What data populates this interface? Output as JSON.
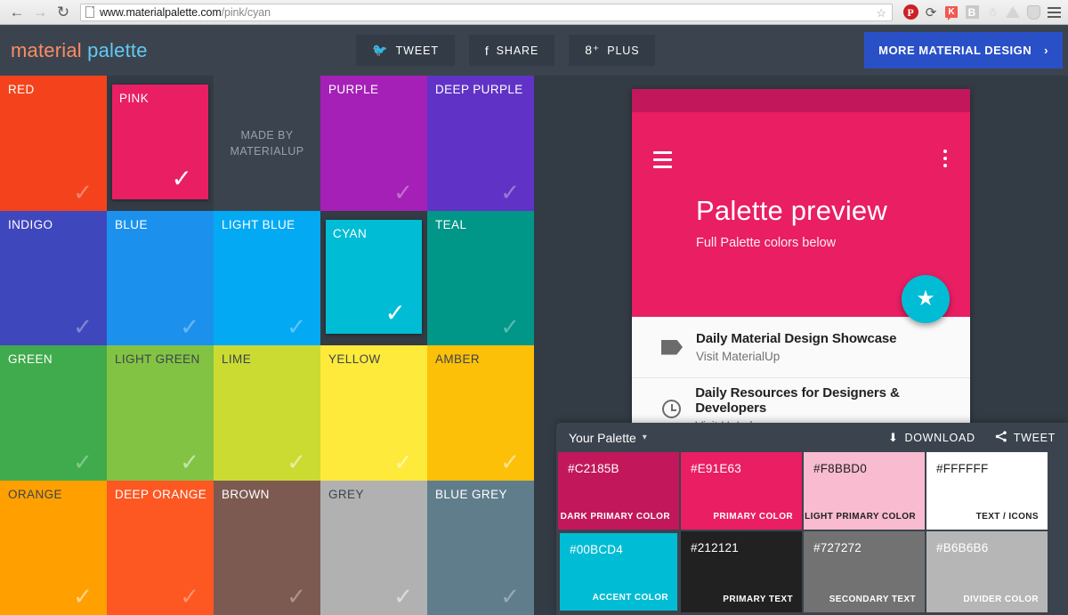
{
  "browser": {
    "back_icon": "back-arrow-icon",
    "forward_icon": "forward-arrow-icon",
    "reload_icon": "reload-icon",
    "url_host": "www.materialpalette.com",
    "url_path": "/pink/cyan",
    "bookmark_icon": "star-icon",
    "extensions": [
      {
        "name": "pinterest-extension",
        "label": "P"
      },
      {
        "name": "sync-extension",
        "label": "↻"
      },
      {
        "name": "kippt-extension",
        "label": "K"
      },
      {
        "name": "bold-extension",
        "label": "B"
      },
      {
        "name": "unknown-extension",
        "label": ""
      },
      {
        "name": "google-drive-extension",
        "label": ""
      },
      {
        "name": "shield-extension",
        "label": ""
      }
    ],
    "menu_icon": "hamburger-menu-icon"
  },
  "header": {
    "logo_first": "material",
    "logo_second": "palette",
    "logo_color_first": "#fa8c66",
    "logo_color_second": "#62c9f5",
    "social": [
      {
        "name": "tweet-button",
        "icon": "twitter-icon",
        "glyph": "🐦",
        "label": "TWEET"
      },
      {
        "name": "share-button",
        "icon": "facebook-icon",
        "glyph": "f",
        "label": "SHARE"
      },
      {
        "name": "plus-button",
        "icon": "google-plus-icon",
        "glyph": "8⁺",
        "label": "PLUS"
      }
    ],
    "more_button": {
      "label": "MORE MATERIAL DESIGN",
      "chevron": "›",
      "color": "#2a50c8"
    }
  },
  "palette_grid": {
    "check_glyph": "✓",
    "made_by_line1": "MADE BY",
    "made_by_line2": "MATERIALUP",
    "tiles": [
      {
        "name": "RED",
        "color": "#f4431c",
        "text": "light",
        "selected": false
      },
      {
        "name": "PINK",
        "color": "#e91e63",
        "text": "light",
        "selected": true
      },
      {
        "name": "MADE BY",
        "color": "#3b444e",
        "text": "made-by",
        "selected": false
      },
      {
        "name": "PURPLE",
        "color": "#a520b7",
        "text": "light",
        "selected": false
      },
      {
        "name": "DEEP PURPLE",
        "color": "#6033c6",
        "text": "light",
        "selected": false
      },
      {
        "name": "INDIGO",
        "color": "#3f47bd",
        "text": "light",
        "selected": false
      },
      {
        "name": "BLUE",
        "color": "#1b91ed",
        "text": "light",
        "selected": false
      },
      {
        "name": "LIGHT BLUE",
        "color": "#04a9f4",
        "text": "light",
        "selected": false
      },
      {
        "name": "CYAN",
        "color": "#00bcd4",
        "text": "light",
        "selected": true
      },
      {
        "name": "TEAL",
        "color": "#009688",
        "text": "light",
        "selected": false
      },
      {
        "name": "GREEN",
        "color": "#40ab4c",
        "text": "light",
        "selected": false
      },
      {
        "name": "LIGHT GREEN",
        "color": "#82c343",
        "text": "dark",
        "selected": false
      },
      {
        "name": "LIME",
        "color": "#cbdb32",
        "text": "dark",
        "selected": false
      },
      {
        "name": "YELLOW",
        "color": "#feea3a",
        "text": "dark",
        "selected": false
      },
      {
        "name": "AMBER",
        "color": "#fdc008",
        "text": "dark",
        "selected": false
      },
      {
        "name": "ORANGE",
        "color": "#ffa000",
        "text": "dark",
        "selected": false
      },
      {
        "name": "DEEP ORANGE",
        "color": "#fd5722",
        "text": "light",
        "selected": false
      },
      {
        "name": "BROWN",
        "color": "#7d5a51",
        "text": "light",
        "selected": false
      },
      {
        "name": "GREY",
        "color": "#b1b1b1",
        "text": "dark",
        "selected": false
      },
      {
        "name": "BLUE GREY",
        "color": "#607d8b",
        "text": "light",
        "selected": false
      }
    ]
  },
  "phone_preview": {
    "status_bar_color": "#c2185b",
    "app_bar_color": "#e91e63",
    "menu_icon": "hamburger-menu-icon",
    "overflow_icon": "kebab-menu-icon",
    "title": "Palette preview",
    "subtitle": "Full Palette colors below",
    "fab": {
      "icon": "star-icon",
      "glyph": "★",
      "color": "#00bcd4"
    },
    "list": [
      {
        "icon": "tag-icon",
        "title": "Daily Material Design Showcase",
        "subtitle": "Visit MaterialUp"
      },
      {
        "icon": "clock-icon",
        "title": "Daily Resources for Designers & Developers",
        "subtitle": "Visit UpLabs"
      }
    ]
  },
  "your_palette": {
    "title": "Your Palette",
    "chevron": "▾",
    "download_label": "DOWNLOAD",
    "download_icon": "download-icon",
    "download_glyph": "⬇",
    "tweet_label": "TWEET",
    "tweet_icon": "share-icon",
    "tweet_glyph": "‹",
    "swatches": [
      {
        "hex": "#C2185B",
        "role": "DARK PRIMARY COLOR",
        "text": "light",
        "accent": false
      },
      {
        "hex": "#E91E63",
        "role": "PRIMARY COLOR",
        "text": "light",
        "accent": false
      },
      {
        "hex": "#F8BBD0",
        "role": "LIGHT PRIMARY COLOR",
        "text": "dark",
        "accent": false
      },
      {
        "hex": "#FFFFFF",
        "role": "TEXT / ICONS",
        "text": "dark",
        "accent": false
      },
      {
        "hex": "#00BCD4",
        "role": "ACCENT COLOR",
        "text": "light",
        "accent": true
      },
      {
        "hex": "#212121",
        "role": "PRIMARY TEXT",
        "text": "light",
        "accent": false
      },
      {
        "hex": "#727272",
        "role": "SECONDARY TEXT",
        "text": "light",
        "accent": false
      },
      {
        "hex": "#B6B6B6",
        "role": "DIVIDER COLOR",
        "text": "light",
        "accent": false
      }
    ]
  }
}
